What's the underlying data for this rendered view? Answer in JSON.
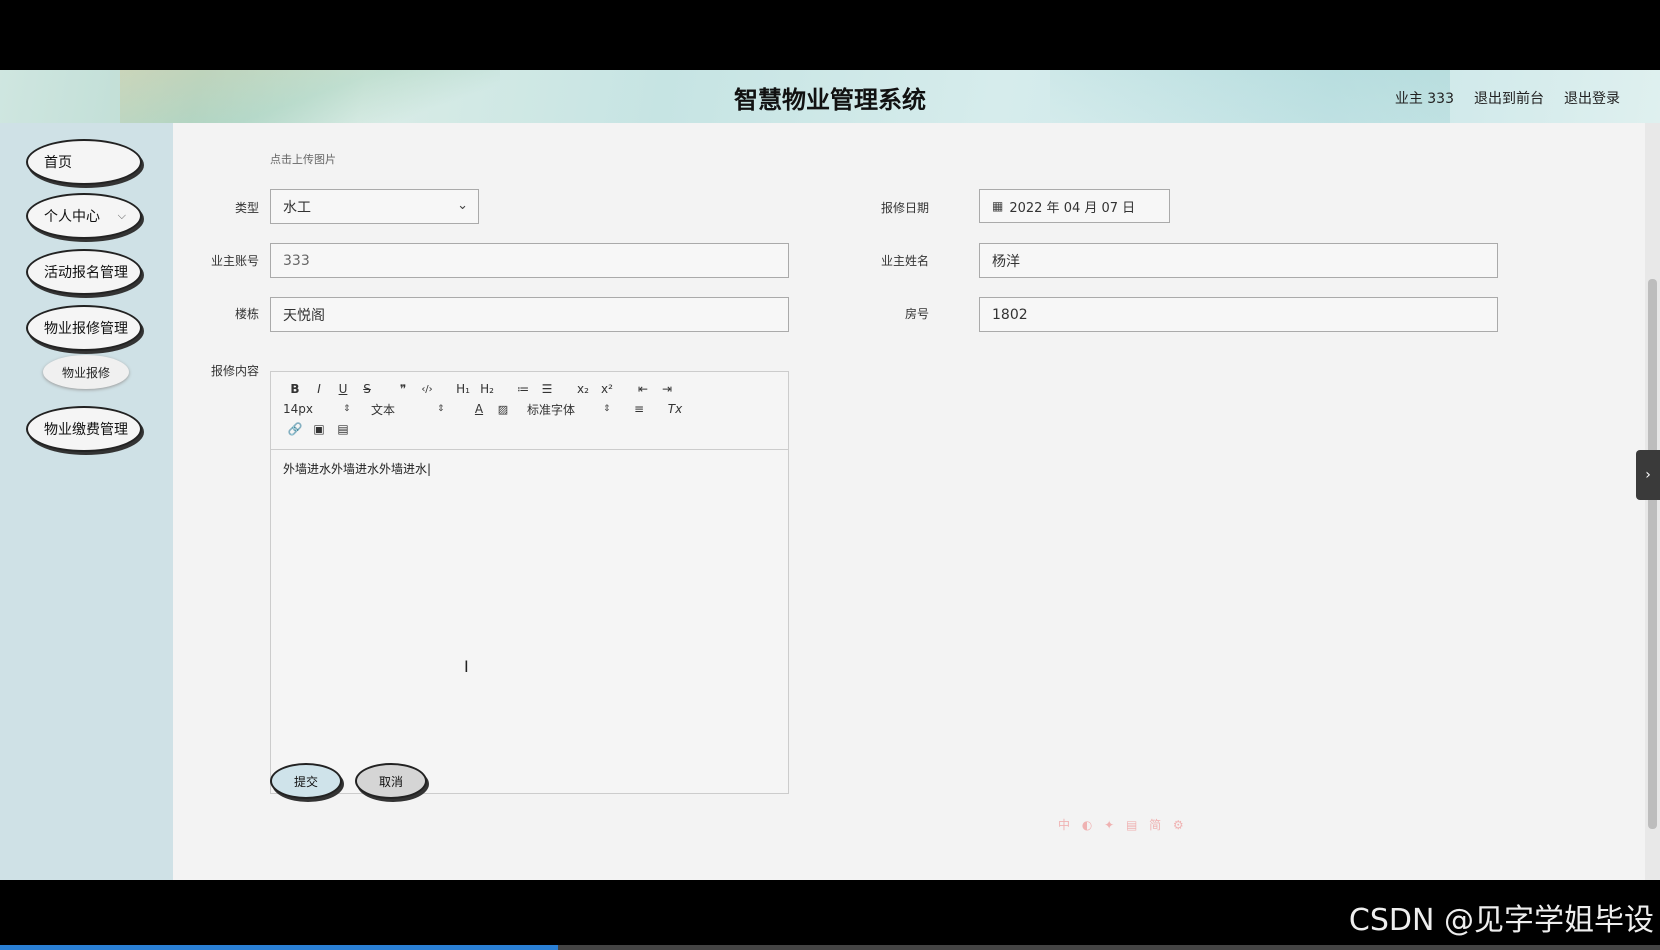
{
  "header": {
    "title": "智慧物业管理系统",
    "user_label": "业主 333",
    "to_front_label": "退出到前台",
    "logout_label": "退出登录"
  },
  "sidebar": {
    "items": [
      {
        "label": "首页"
      },
      {
        "label": "个人中心"
      },
      {
        "label": "活动报名管理"
      },
      {
        "label": "物业报修管理"
      },
      {
        "label": "物业报修"
      },
      {
        "label": "物业缴费管理"
      }
    ]
  },
  "form": {
    "upload_hint": "点击上传图片",
    "type_label": "类型",
    "type_value": "水工",
    "date_label": "报修日期",
    "date_value": "2022 年 04 月 07 日",
    "account_label": "业主账号",
    "account_value": "333",
    "name_label": "业主姓名",
    "name_value": "杨洋",
    "building_label": "楼栋",
    "building_value": "天悦阁",
    "room_label": "房号",
    "room_value": "1802",
    "content_label": "报修内容"
  },
  "editor": {
    "bold": "B",
    "italic": "I",
    "underline": "U",
    "strike": "S",
    "blockquote": "❞",
    "code": "‹/›",
    "h1": "H₁",
    "h2": "H₂",
    "ordered_list": "≔",
    "bullet_list": "☰",
    "subscript": "x₂",
    "superscript": "x²",
    "outdent": "⇤",
    "indent": "⇥",
    "size_value": "14px",
    "header_value": "文本",
    "font_value": "标准字体",
    "content": "外墙进水外墙进水外墙进水"
  },
  "actions": {
    "submit_label": "提交",
    "cancel_label": "取消"
  },
  "overlay": {
    "watermark": "CSDN @见字学姐毕设",
    "ime_text": "中 ◐ ✦ ▤ 简 ⚙",
    "video_progress": 0.336
  },
  "colors": {
    "sidebar_bg": "#cfe1e6",
    "main_bg": "#f3f3f3",
    "submit_bg": "#cfe3ea",
    "cancel_bg": "#d5d5d5"
  }
}
